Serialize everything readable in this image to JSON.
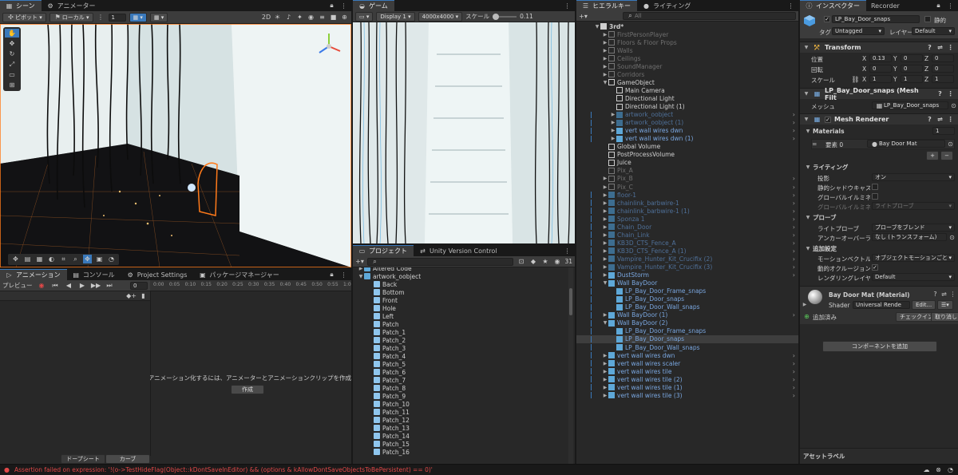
{
  "scene": {
    "tabs": [
      {
        "label": "シーン"
      },
      {
        "label": "アニメーター"
      }
    ],
    "toolbar": {
      "pivot": "ピボット",
      "local": "ローカル",
      "grid_value": "1"
    }
  },
  "game": {
    "tab": "ゲーム",
    "display": "Display 1",
    "resolution": "4000x4000",
    "scale_label": "スケール",
    "scale_value": "0.11"
  },
  "animation": {
    "tabs": [
      {
        "label": "アニメーション"
      },
      {
        "label": "コンソール"
      },
      {
        "label": "Project Settings"
      },
      {
        "label": "パッケージマネージャー"
      }
    ],
    "preview": "プレビュー",
    "frame": "0",
    "ticks": [
      "0:00",
      "0:05",
      "0:10",
      "0:15",
      "0:20",
      "0:25",
      "0:30",
      "0:35",
      "0:40",
      "0:45",
      "0:50",
      "0:55",
      "1:00"
    ],
    "message": "LP_Bay_Door_snapsをアニメーション化するには、アニメーターとアニメーションクリップを作成",
    "create_button": "作成",
    "bottom_tabs": [
      "ドープシート",
      "カーブ"
    ]
  },
  "project": {
    "tabs": [
      {
        "label": "プロジェクト"
      },
      {
        "label": "Unity Version Control"
      }
    ],
    "count": "31",
    "items": [
      {
        "label": "Altered Code",
        "level": 0,
        "folder": true,
        "open": false
      },
      {
        "label": "artwork_oobject",
        "level": 0,
        "folder": true,
        "open": true
      },
      {
        "label": "Back",
        "level": 1
      },
      {
        "label": "Bottom",
        "level": 1
      },
      {
        "label": "Front",
        "level": 1
      },
      {
        "label": "Hole",
        "level": 1
      },
      {
        "label": "Left",
        "level": 1
      },
      {
        "label": "Patch",
        "level": 1
      },
      {
        "label": "Patch_1",
        "level": 1
      },
      {
        "label": "Patch_2",
        "level": 1
      },
      {
        "label": "Patch_3",
        "level": 1
      },
      {
        "label": "Patch_4",
        "level": 1
      },
      {
        "label": "Patch_5",
        "level": 1
      },
      {
        "label": "Patch_6",
        "level": 1
      },
      {
        "label": "Patch_7",
        "level": 1
      },
      {
        "label": "Patch_8",
        "level": 1
      },
      {
        "label": "Patch_9",
        "level": 1
      },
      {
        "label": "Patch_10",
        "level": 1
      },
      {
        "label": "Patch_11",
        "level": 1
      },
      {
        "label": "Patch_12",
        "level": 1
      },
      {
        "label": "Patch_13",
        "level": 1
      },
      {
        "label": "Patch_14",
        "level": 1
      },
      {
        "label": "Patch_15",
        "level": 1
      },
      {
        "label": "Patch_16",
        "level": 1
      }
    ]
  },
  "hierarchy": {
    "tabs": [
      {
        "label": "ヒエラルキー"
      },
      {
        "label": "ライティング"
      }
    ],
    "search_placeholder": "All",
    "items": [
      {
        "label": "3rd*",
        "level": 0,
        "type": "scene",
        "open": true
      },
      {
        "label": "FirstPersonPlayer",
        "level": 1,
        "type": "dim",
        "arrow": "closed"
      },
      {
        "label": "Floors & Floor Props",
        "level": 1,
        "type": "dim",
        "arrow": "closed"
      },
      {
        "label": "Walls",
        "level": 1,
        "type": "dim",
        "arrow": "closed"
      },
      {
        "label": "Ceilings",
        "level": 1,
        "type": "dim",
        "arrow": "closed"
      },
      {
        "label": "SoundManager",
        "level": 1,
        "type": "dim",
        "arrow": "closed"
      },
      {
        "label": "Corridors",
        "level": 1,
        "type": "dim",
        "arrow": "closed"
      },
      {
        "label": "GameObject",
        "level": 1,
        "type": "normal",
        "arrow": "open"
      },
      {
        "label": "Main Camera",
        "level": 2,
        "type": "normal"
      },
      {
        "label": "Directional Light",
        "level": 2,
        "type": "normal"
      },
      {
        "label": "Directional Light (1)",
        "level": 2,
        "type": "normal"
      },
      {
        "label": "artwork_oobject",
        "level": 2,
        "type": "bluedim",
        "arrow": "closed",
        "more": true
      },
      {
        "label": "artwork_oobject (1)",
        "level": 2,
        "type": "bluedim",
        "arrow": "closed",
        "more": true
      },
      {
        "label": "vert wall wires dwn",
        "level": 2,
        "type": "blue",
        "arrow": "closed",
        "more": true
      },
      {
        "label": "vert wall wires dwn (1)",
        "level": 2,
        "type": "blue",
        "arrow": "closed",
        "more": true
      },
      {
        "label": "Global Volume",
        "level": 1,
        "type": "normal"
      },
      {
        "label": "PostProcessVolume",
        "level": 1,
        "type": "normal"
      },
      {
        "label": "Juice",
        "level": 1,
        "type": "normal"
      },
      {
        "label": "Pix_A",
        "level": 1,
        "type": "dim"
      },
      {
        "label": "Pix_B",
        "level": 1,
        "type": "dim",
        "arrow": "closed",
        "more": true
      },
      {
        "label": "Pix_C",
        "level": 1,
        "type": "dim",
        "arrow": "closed",
        "more": true
      },
      {
        "label": "floor-1",
        "level": 1,
        "type": "bluedim",
        "arrow": "closed",
        "more": true
      },
      {
        "label": "chainlink_barbwire-1",
        "level": 1,
        "type": "bluedim",
        "arrow": "closed",
        "more": true
      },
      {
        "label": "chainlink_barbwire-1 (1)",
        "level": 1,
        "type": "bluedim",
        "arrow": "closed",
        "more": true
      },
      {
        "label": "Sponza 1",
        "level": 1,
        "type": "bluedim",
        "arrow": "closed",
        "more": true
      },
      {
        "label": "Chain_Door",
        "level": 1,
        "type": "bluedim",
        "arrow": "closed",
        "more": true
      },
      {
        "label": "Chain_Link",
        "level": 1,
        "type": "bluedim",
        "arrow": "closed",
        "more": true
      },
      {
        "label": "KB3D_CTS_Fence_A",
        "level": 1,
        "type": "bluedim",
        "arrow": "closed",
        "more": true
      },
      {
        "label": "KB3D_CTS_Fence_A (1)",
        "level": 1,
        "type": "bluedim",
        "arrow": "closed",
        "more": true
      },
      {
        "label": "Vampire_Hunter_Kit_Crucifix (2)",
        "level": 1,
        "type": "bluedim",
        "arrow": "closed",
        "more": true
      },
      {
        "label": "Vampire_Hunter_Kit_Crucifix (3)",
        "level": 1,
        "type": "bluedim",
        "arrow": "closed",
        "more": true
      },
      {
        "label": "DustStorm",
        "level": 1,
        "type": "blue",
        "arrow": "closed",
        "more": true
      },
      {
        "label": "Wall BayDoor",
        "level": 1,
        "type": "blue",
        "arrow": "open"
      },
      {
        "label": "LP_Bay_Door_Frame_snaps",
        "level": 2,
        "type": "blue"
      },
      {
        "label": "LP_Bay_Door_snaps",
        "level": 2,
        "type": "blue"
      },
      {
        "label": "LP_Bay_Door_Wall_snaps",
        "level": 2,
        "type": "blue"
      },
      {
        "label": "Wall BayDoor (1)",
        "level": 1,
        "type": "blue",
        "arrow": "closed",
        "more": true
      },
      {
        "label": "Wall BayDoor (2)",
        "level": 1,
        "type": "blue",
        "arrow": "open"
      },
      {
        "label": "LP_Bay_Door_Frame_snaps",
        "level": 2,
        "type": "blue"
      },
      {
        "label": "LP_Bay_Door_snaps",
        "level": 2,
        "type": "blue",
        "selected": true
      },
      {
        "label": "LP_Bay_Door_Wall_snaps",
        "level": 2,
        "type": "blue"
      },
      {
        "label": "vert wall wires dwn",
        "level": 1,
        "type": "blue",
        "arrow": "closed",
        "more": true
      },
      {
        "label": "vert wall wires scaler",
        "level": 1,
        "type": "blue",
        "arrow": "closed",
        "more": true
      },
      {
        "label": "vert wall wires tile",
        "level": 1,
        "type": "blue",
        "arrow": "closed",
        "more": true
      },
      {
        "label": "vert wall wires tile (2)",
        "level": 1,
        "type": "blue",
        "arrow": "closed",
        "more": true
      },
      {
        "label": "vert wall wires tile (1)",
        "level": 1,
        "type": "blue",
        "arrow": "closed",
        "more": true
      },
      {
        "label": "vert wall wires tile (3)",
        "level": 1,
        "type": "blue",
        "arrow": "closed",
        "more": true
      }
    ]
  },
  "inspector": {
    "tabs": [
      {
        "label": "インスペクター"
      },
      {
        "label": "Recorder"
      }
    ],
    "object_name": "LP_Bay_Door_snaps",
    "static_label": "静的",
    "tag_label": "タグ",
    "tag_value": "Untagged",
    "layer_label": "レイヤー",
    "layer_value": "Default",
    "transform": {
      "title": "Transform",
      "position_label": "位置",
      "position": [
        "0.13",
        "0",
        "0"
      ],
      "rotation_label": "回転",
      "rotation": [
        "0",
        "0",
        "0"
      ],
      "scale_label": "スケール",
      "scale": [
        "1",
        "1",
        "1"
      ]
    },
    "mesh_filter": {
      "title": "LP_Bay_Door_snaps (Mesh Filt",
      "mesh_label": "メッシュ",
      "mesh_value": "LP_Bay_Door_snaps"
    },
    "mesh_renderer": {
      "title": "Mesh Renderer",
      "materials_label": "Materials",
      "materials_count": "1",
      "element_label": "要素 0",
      "element_value": "Bay Door Mat",
      "lighting_label": "ライティング",
      "cast_shadows_label": "投影",
      "cast_shadows_value": "オン",
      "static_shadow_label": "静的シャドウキャスター",
      "gi_label": "グローバルイルミネーション",
      "gi_recv_label": "グローバルイルミネーション",
      "gi_recv_value": "ライトプローブ",
      "probes_label": "プローブ",
      "light_probes_label": "ライトプローブ",
      "light_probes_value": "プローブをブレンド",
      "anchor_label": "アンカーオーバーライド",
      "anchor_value": "なし (トランスフォーム)",
      "additional_label": "追加設定",
      "motion_label": "モーションベクトル",
      "motion_value": "オブジェクトモーションごと",
      "occlusion_label": "動的オクルージョン",
      "layer_mask_label": "レンダリングレイヤーマスク",
      "layer_mask_value": "Default"
    },
    "material": {
      "title": "Bay Door Mat (Material)",
      "shader_label": "Shader",
      "shader_value": "Universal Rende",
      "edit_button": "Edit...",
      "added_label": "追加済み",
      "checkin_button": "チェックイン",
      "cancel_button": "取り消し"
    },
    "add_component_button": "コンポーネントを追加",
    "asset_labels": "アセットラベル"
  },
  "status": {
    "error": "Assertion failed on expression: '!(o->TestHideFlag(Object::kDontSaveInEditor) && (options & kAllowDontSaveObjectsToBePersistent) == 0)'"
  },
  "colors": {
    "accent": "#3a79bb",
    "error": "#e04848",
    "prefab_blue": "#7aa7e0",
    "selection_orange": "#ff7a1a"
  }
}
